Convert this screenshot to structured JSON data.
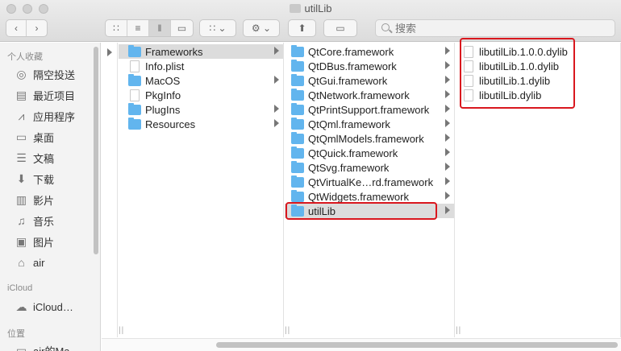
{
  "window": {
    "title": "utilLib"
  },
  "toolbar": {
    "search_placeholder": "搜索",
    "icons": [
      "chevron-left-icon",
      "chevron-right-icon",
      "icon-view-icon",
      "list-view-icon",
      "column-view-icon",
      "gallery-view-icon",
      "group-icon",
      "gear-icon",
      "share-icon",
      "tag-icon"
    ]
  },
  "sidebar": {
    "favorites_header": "个人收藏",
    "favorites": [
      {
        "label": "隔空投送",
        "icon": "airdrop-icon"
      },
      {
        "label": "最近项目",
        "icon": "recents-icon"
      },
      {
        "label": "应用程序",
        "icon": "applications-icon"
      },
      {
        "label": "桌面",
        "icon": "desktop-icon"
      },
      {
        "label": "文稿",
        "icon": "documents-icon"
      },
      {
        "label": "下载",
        "icon": "downloads-icon"
      },
      {
        "label": "影片",
        "icon": "movies-icon"
      },
      {
        "label": "音乐",
        "icon": "music-icon"
      },
      {
        "label": "图片",
        "icon": "pictures-icon"
      },
      {
        "label": "air",
        "icon": "home-icon"
      }
    ],
    "icloud_header": "iCloud",
    "icloud_items": [
      {
        "label": "iCloud…",
        "icon": "cloud-icon"
      }
    ],
    "locations_header": "位置",
    "locations_items": [
      {
        "label": "air的Ma…",
        "icon": "computer-icon"
      }
    ]
  },
  "columns": {
    "col1": [
      {
        "name": "Frameworks",
        "type": "folder",
        "has_children": true,
        "selected": true
      },
      {
        "name": "Info.plist",
        "type": "file",
        "has_children": false
      },
      {
        "name": "MacOS",
        "type": "folder",
        "has_children": true
      },
      {
        "name": "PkgInfo",
        "type": "file",
        "has_children": false
      },
      {
        "name": "PlugIns",
        "type": "folder",
        "has_children": true
      },
      {
        "name": "Resources",
        "type": "folder",
        "has_children": true
      }
    ],
    "col2": [
      {
        "name": "QtCore.framework",
        "type": "folder",
        "has_children": true
      },
      {
        "name": "QtDBus.framework",
        "type": "folder",
        "has_children": true
      },
      {
        "name": "QtGui.framework",
        "type": "folder",
        "has_children": true
      },
      {
        "name": "QtNetwork.framework",
        "type": "folder",
        "has_children": true
      },
      {
        "name": "QtPrintSupport.framework",
        "type": "folder",
        "has_children": true
      },
      {
        "name": "QtQml.framework",
        "type": "folder",
        "has_children": true
      },
      {
        "name": "QtQmlModels.framework",
        "type": "folder",
        "has_children": true
      },
      {
        "name": "QtQuick.framework",
        "type": "folder",
        "has_children": true
      },
      {
        "name": "QtSvg.framework",
        "type": "folder",
        "has_children": true
      },
      {
        "name": "QtVirtualKe…rd.framework",
        "type": "folder",
        "has_children": true
      },
      {
        "name": "QtWidgets.framework",
        "type": "folder",
        "has_children": true
      },
      {
        "name": "utilLib",
        "type": "folder",
        "has_children": true,
        "selected": true
      }
    ],
    "col3": [
      {
        "name": "libutilLib.1.0.0.dylib",
        "type": "file"
      },
      {
        "name": "libutilLib.1.0.dylib",
        "type": "alias"
      },
      {
        "name": "libutilLib.1.dylib",
        "type": "alias"
      },
      {
        "name": "libutilLib.dylib",
        "type": "alias"
      }
    ]
  },
  "highlight_color": "#d9171e"
}
